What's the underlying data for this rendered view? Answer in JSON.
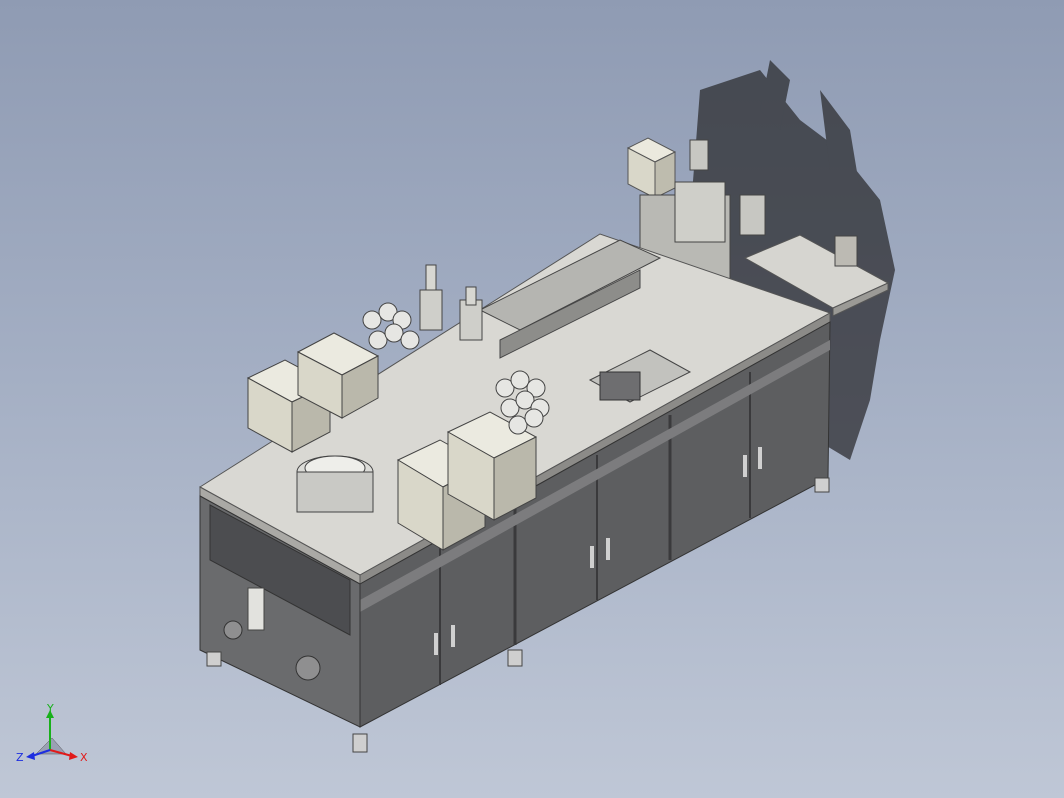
{
  "view": {
    "background_top": "#8f9bb3",
    "background_bottom": "#bfc7d6"
  },
  "model": {
    "frame_color": "#6f6f70",
    "panel_color": "#5d5e60",
    "table_top_color": "#d9d8d3",
    "box_color": "#d8d6c8",
    "shadow_color": "#2d2e31"
  },
  "triad": {
    "x_label": "X",
    "y_label": "Y",
    "z_label": "Z",
    "x_color": "#e11a1a",
    "y_color": "#18b01b",
    "z_color": "#1d2ee0"
  }
}
